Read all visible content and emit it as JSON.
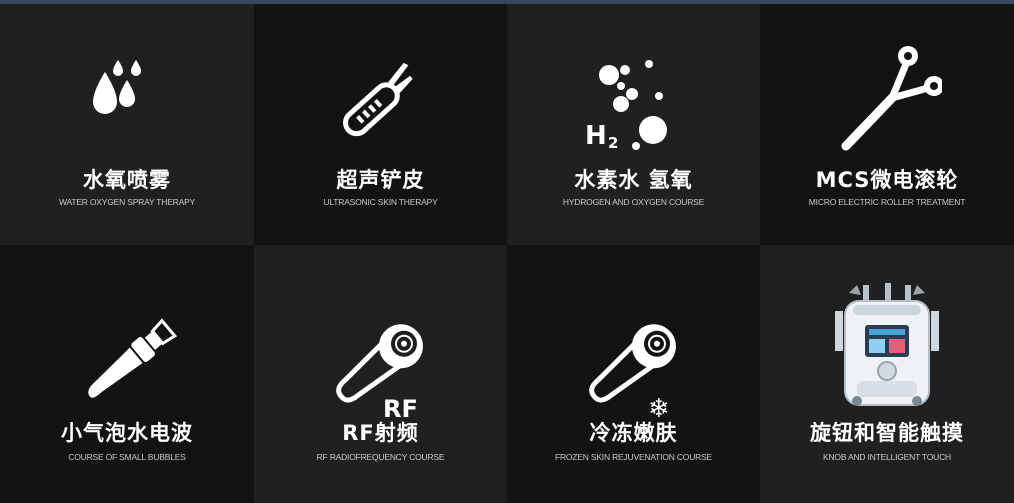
{
  "colors": {
    "background_dark": "#131313",
    "background_light": "#202020",
    "text": "#ffffff",
    "subtext": "#c9c9c9",
    "top_bar": "#3a4560"
  },
  "tiles": [
    {
      "title": "水氧喷雾",
      "subtitle": "WATER OXYGEN SPRAY THERAPY",
      "icon": "water-drops-icon"
    },
    {
      "title": "超声铲皮",
      "subtitle": "ULTRASONIC SKIN THERAPY",
      "icon": "ultrasonic-spatula-icon"
    },
    {
      "title": "水素水 氢氧",
      "subtitle": "HYDROGEN AND OXYGEN COURSE",
      "icon": "hydrogen-bubbles-icon",
      "icon_text": "H",
      "icon_subscript": "2"
    },
    {
      "title": "MCS微电滚轮",
      "subtitle": "MICRO ELECTRIC ROLLER TREATMENT",
      "icon": "micro-current-roller-icon"
    },
    {
      "title": "小气泡水电波",
      "subtitle": "COURSE OF SMALL BUBBLES",
      "icon": "small-bubble-wand-icon"
    },
    {
      "title": "RF射频",
      "subtitle": "RF RADIOFREQUENCY COURSE",
      "icon": "rf-wand-icon",
      "icon_text": "RF"
    },
    {
      "title": "冷冻嫩肤",
      "subtitle": "FROZEN SKIN REJUVENATION COURSE",
      "icon": "cryo-wand-icon",
      "icon_text": "❄"
    },
    {
      "title": "旋钮和智能触摸",
      "subtitle": "KNOB AND INTELLIGENT TOUCH",
      "icon": "beauty-machine-icon"
    }
  ]
}
